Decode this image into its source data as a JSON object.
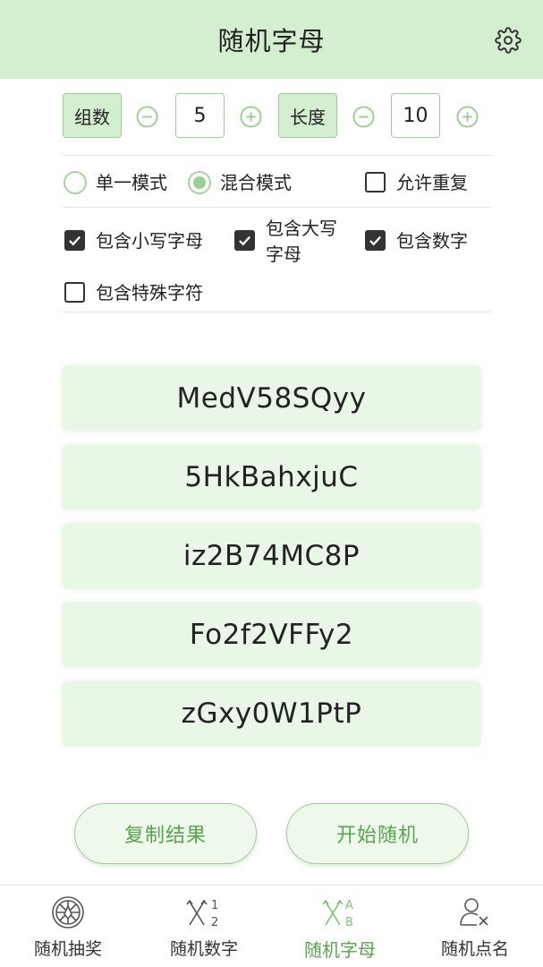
{
  "header": {
    "title": "随机字母",
    "settings_icon": "gear-icon"
  },
  "controls": {
    "group_label": "组数",
    "group_value": "5",
    "length_label": "长度",
    "length_value": "10"
  },
  "modes": {
    "single": "单一模式",
    "mixed": "混合模式",
    "selected": "mixed",
    "allow_repeat": "允许重复",
    "allow_repeat_checked": false
  },
  "options": {
    "lowercase": "包含小写字母",
    "uppercase_line1": "包含大写",
    "uppercase_line2": "字母",
    "digits": "包含数字",
    "special": "包含特殊字符",
    "lowercase_checked": true,
    "uppercase_checked": true,
    "digits_checked": true,
    "special_checked": false
  },
  "results": [
    "MedV58SQyy",
    "5HkBahxjuC",
    "iz2B74MC8P",
    "Fo2f2VFFy2",
    "zGxy0W1PtP"
  ],
  "actions": {
    "copy": "复制结果",
    "start": "开始随机"
  },
  "nav": [
    {
      "label": "随机抽奖",
      "icon": "wheel-icon",
      "active": false
    },
    {
      "label": "随机数字",
      "icon": "shuffle-numbers-icon",
      "icon_text_top": "1",
      "icon_text_bottom": "2",
      "active": false
    },
    {
      "label": "随机字母",
      "icon": "shuffle-letters-icon",
      "icon_text_top": "A",
      "icon_text_bottom": "B",
      "active": true
    },
    {
      "label": "随机点名",
      "icon": "person-pick-icon",
      "active": false
    }
  ],
  "colors": {
    "accent": "#58a34f",
    "header_bg": "#d4efcf",
    "result_bg": "#e9f7e7",
    "border": "#9ccf95"
  }
}
